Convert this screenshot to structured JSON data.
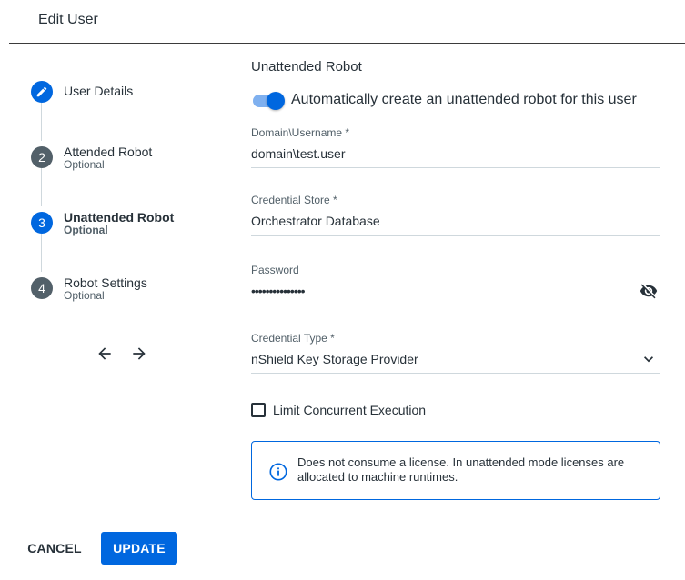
{
  "header": {
    "title": "Edit User"
  },
  "stepper": {
    "steps": [
      {
        "number": "",
        "label": "User Details",
        "sub": "",
        "state": "completed",
        "icon": "pencil-icon"
      },
      {
        "number": "2",
        "label": "Attended Robot",
        "sub": "Optional",
        "state": "inactive"
      },
      {
        "number": "3",
        "label": "Unattended Robot",
        "sub": "Optional",
        "state": "active"
      },
      {
        "number": "4",
        "label": "Robot Settings",
        "sub": "Optional",
        "state": "inactive"
      }
    ],
    "prev_icon": "arrow-left-icon",
    "next_icon": "arrow-right-icon"
  },
  "form": {
    "section_title": "Unattended Robot",
    "toggle": {
      "label": "Automatically create an unattended robot for this user",
      "checked": true
    },
    "domain_username": {
      "label": "Domain\\Username *",
      "value": "domain\\test.user"
    },
    "credential_store": {
      "label": "Credential Store *",
      "value": "Orchestrator Database"
    },
    "password": {
      "label": "Password",
      "value": "•••••••••••••••",
      "icon": "eye-off-icon"
    },
    "credential_type": {
      "label": "Credential Type *",
      "value": "nShield Key Storage Provider",
      "icon": "chevron-down-icon"
    },
    "limit_concurrent": {
      "label": "Limit Concurrent Execution",
      "checked": false
    },
    "info": {
      "icon": "info-icon",
      "text": "Does not consume a license. In unattended mode licenses are allocated to machine runtimes."
    }
  },
  "actions": {
    "cancel_label": "CANCEL",
    "update_label": "UPDATE"
  },
  "colors": {
    "primary": "#0067df",
    "text": "#273139",
    "muted": "#526069",
    "divider": "#cfd8dd"
  }
}
